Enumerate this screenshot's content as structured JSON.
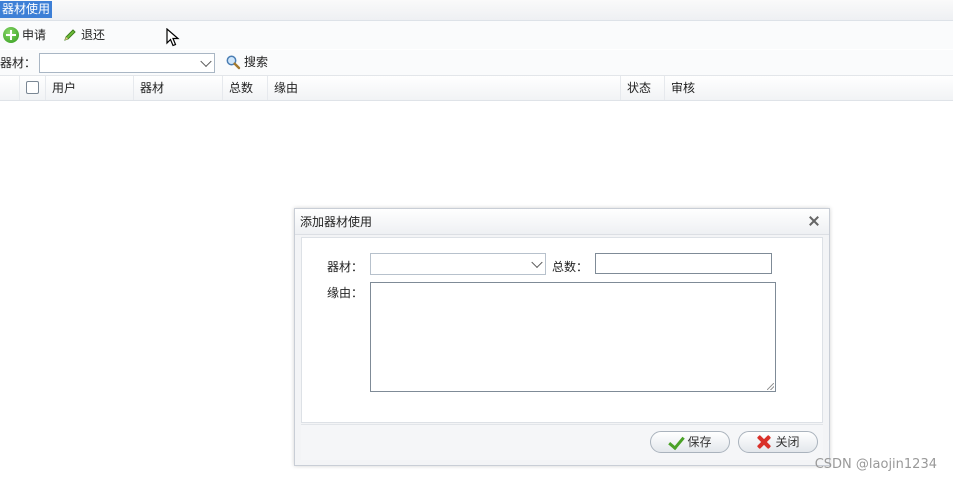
{
  "title_tab": "器材使用",
  "toolbar": {
    "apply_label": "申请",
    "return_label": "退还"
  },
  "search": {
    "equipment_label": "器材：",
    "equipment_value": "",
    "search_label": "搜索"
  },
  "grid": {
    "columns": [
      "用户",
      "器材",
      "总数",
      "缘由",
      "状态",
      "审核"
    ]
  },
  "dialog": {
    "title": "添加器材使用",
    "equipment_label": "器材：",
    "equipment_value": "",
    "total_label": "总数：",
    "total_value": "",
    "reason_label": "缘由：",
    "reason_value": "",
    "save_label": "保存",
    "close_label": "关闭"
  },
  "watermark": "CSDN @laojin1234",
  "colors": {
    "title_tab_bg": "#3d7fd6",
    "save_icon": "#4aa227",
    "close_icon": "#d9312a",
    "add_icon": "#2f9a1a"
  },
  "icons": [
    "add-circle-icon",
    "pencil-icon",
    "magnifier-icon",
    "chevron-down-icon",
    "close-icon",
    "check-icon",
    "x-mark-icon",
    "mouse-cursor-icon"
  ]
}
